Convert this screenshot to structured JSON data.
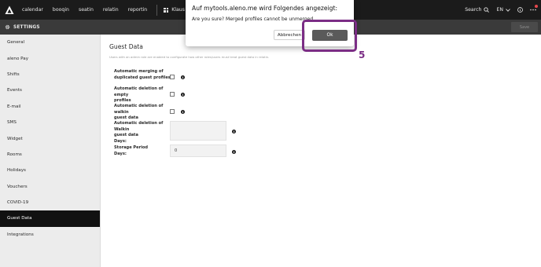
{
  "topnav": {
    "items": [
      "calendar",
      "booqin",
      "seatin",
      "relatin",
      "reportin"
    ],
    "venue": "Klaus Restaurant",
    "search_label": "Search",
    "language": "EN"
  },
  "settingsbar": {
    "title": "SETTINGS",
    "save_label": "Save"
  },
  "sidebar": {
    "items": [
      "General",
      "aleno Pay",
      "Shifts",
      "Events",
      "E-mail",
      "SMS",
      "Widget",
      "Rooms",
      "Holidays",
      "Vouchers",
      "COVID-19",
      "Guest Data",
      "Integrations"
    ],
    "active": "Guest Data"
  },
  "main": {
    "title": "Guest Data",
    "description": "Users with an admin role are enabled to configurate how other roles/users must treat guest data in relatin.",
    "rows": [
      {
        "label1": "Automatic merging of",
        "label2": "duplicated guest profiles"
      },
      {
        "label1": "Automatic deletion of empty",
        "label2": "profiles"
      },
      {
        "label1": "Automatic deletion of walkin",
        "label2": "guest data"
      },
      {
        "label1": "Automatic deletion of Walkin",
        "label2": "guest data",
        "label3": "Days:",
        "value": ""
      },
      {
        "label1": "Storage Period",
        "label2": "Days:",
        "value": "0"
      }
    ],
    "info_glyph": "i"
  },
  "dialog": {
    "title": "Auf mytools.aleno.me wird Folgendes angezeigt:",
    "message": "Are you sure? Merged profiles cannot be unmerged.",
    "cancel_label": "Abbrechen",
    "ok_label": "Ok"
  },
  "annotation": {
    "step": "5",
    "color": "#7b2d85"
  }
}
